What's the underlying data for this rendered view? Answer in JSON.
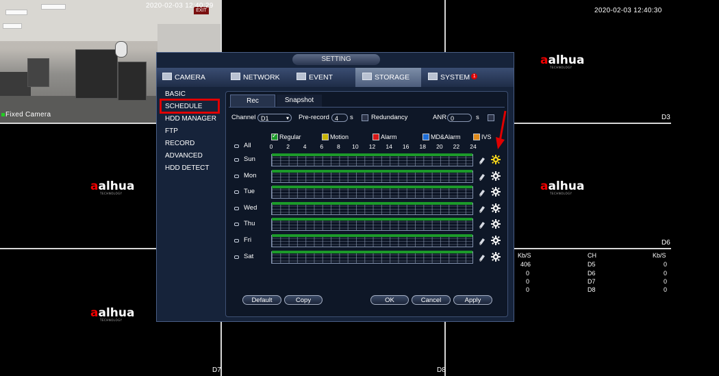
{
  "tiles": {
    "top_left_timestamp": "2020-02-03 12:40:29",
    "top_right_timestamp": "2020-02-03 12:40:30",
    "top_left_camera_name": "Fixed Camera",
    "logo_text": "alhua",
    "channel_labels": {
      "d3": "D3",
      "d6": "D6",
      "d7": "D7",
      "d8": "D8"
    },
    "bitrate_table": {
      "headers": [
        "Kb/S",
        "CH",
        "Kb/S"
      ],
      "rows": [
        [
          "406",
          "D5",
          "0"
        ],
        [
          "0",
          "D6",
          "0"
        ],
        [
          "0",
          "D7",
          "0"
        ],
        [
          "0",
          "D8",
          "0"
        ]
      ]
    }
  },
  "dialog": {
    "title": "SETTING",
    "tabs": [
      {
        "label": "CAMERA",
        "icon": "camera-icon"
      },
      {
        "label": "NETWORK",
        "icon": "network-icon"
      },
      {
        "label": "EVENT",
        "icon": "event-icon"
      },
      {
        "label": "STORAGE",
        "icon": "storage-icon"
      },
      {
        "label": "SYSTEM",
        "icon": "system-icon",
        "badge": "1"
      }
    ],
    "active_tab": "STORAGE",
    "menu": [
      "BASIC",
      "SCHEDULE",
      "HDD MANAGER",
      "FTP",
      "RECORD",
      "ADVANCED",
      "HDD DETECT"
    ],
    "active_menu": "SCHEDULE",
    "subtabs": [
      "Rec",
      "Snapshot"
    ],
    "channel_label": "Channel",
    "channel_value": "D1",
    "prerecord_label": "Pre-record",
    "prerecord_value": "4",
    "prerecord_unit": "s",
    "redundancy_label": "Redundancy",
    "anr_label": "ANR",
    "anr_value": "0",
    "anr_unit": "s",
    "legend": [
      {
        "label": "Regular",
        "color": "#1c9a2a",
        "checked": true
      },
      {
        "label": "Motion",
        "color": "#c8b400",
        "checked": false
      },
      {
        "label": "Alarm",
        "color": "#d81818",
        "checked": false
      },
      {
        "label": "MD&Alarm",
        "color": "#1e6ed8",
        "checked": false
      },
      {
        "label": "IVS",
        "color": "#e08a1a",
        "checked": false
      }
    ],
    "all_label": "All",
    "hours": [
      "0",
      "2",
      "4",
      "6",
      "8",
      "10",
      "12",
      "14",
      "16",
      "18",
      "20",
      "22",
      "24"
    ],
    "days": [
      "Sun",
      "Mon",
      "Tue",
      "Wed",
      "Thu",
      "Fri",
      "Sat"
    ],
    "buttons": {
      "default": "Default",
      "copy": "Copy",
      "ok": "OK",
      "cancel": "Cancel",
      "apply": "Apply"
    }
  }
}
